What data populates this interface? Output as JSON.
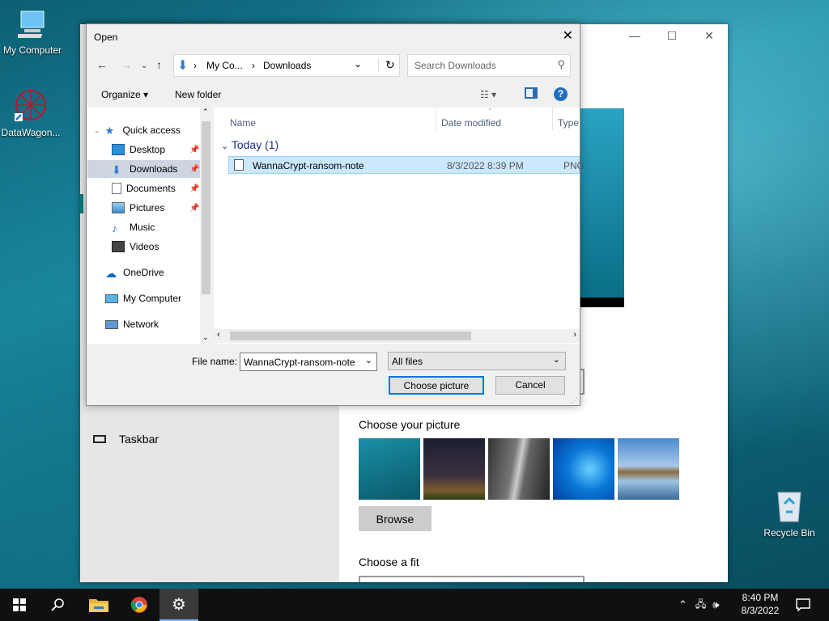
{
  "desktop": {
    "icons": [
      {
        "label": "My Computer"
      },
      {
        "label": "DataWagon..."
      },
      {
        "label": "Recycle Bin"
      }
    ]
  },
  "settings": {
    "taskbar_label": "Taskbar",
    "choose_picture_label": "Choose your picture",
    "browse_label": "Browse",
    "choose_fit_label": "Choose a fit",
    "minimize": "—",
    "maximize": "☐",
    "close": "✕"
  },
  "dialog": {
    "title": "Open",
    "close": "✕",
    "address": {
      "segment1": "My Co...",
      "segment2": "Downloads"
    },
    "search_placeholder": "Search Downloads",
    "toolbar": {
      "organize": "Organize ▾",
      "new_folder": "New folder"
    },
    "nav": [
      {
        "label": "Quick access"
      },
      {
        "label": "Desktop"
      },
      {
        "label": "Downloads"
      },
      {
        "label": "Documents"
      },
      {
        "label": "Pictures"
      },
      {
        "label": "Music"
      },
      {
        "label": "Videos"
      },
      {
        "label": "OneDrive"
      },
      {
        "label": "My Computer"
      },
      {
        "label": "Network"
      }
    ],
    "columns": {
      "name": "Name",
      "date": "Date modified",
      "type": "Type"
    },
    "group_label": "Today (1)",
    "file": {
      "name": "WannaCrypt-ransom-note",
      "date": "8/3/2022 8:39 PM",
      "type": "PNG"
    },
    "file_name_label": "File name:",
    "file_name_value": "WannaCrypt-ransom-note",
    "file_type_value": "All files",
    "choose_button": "Choose picture",
    "cancel_button": "Cancel"
  },
  "taskbar": {
    "time": "8:40 PM",
    "date": "8/3/2022"
  }
}
